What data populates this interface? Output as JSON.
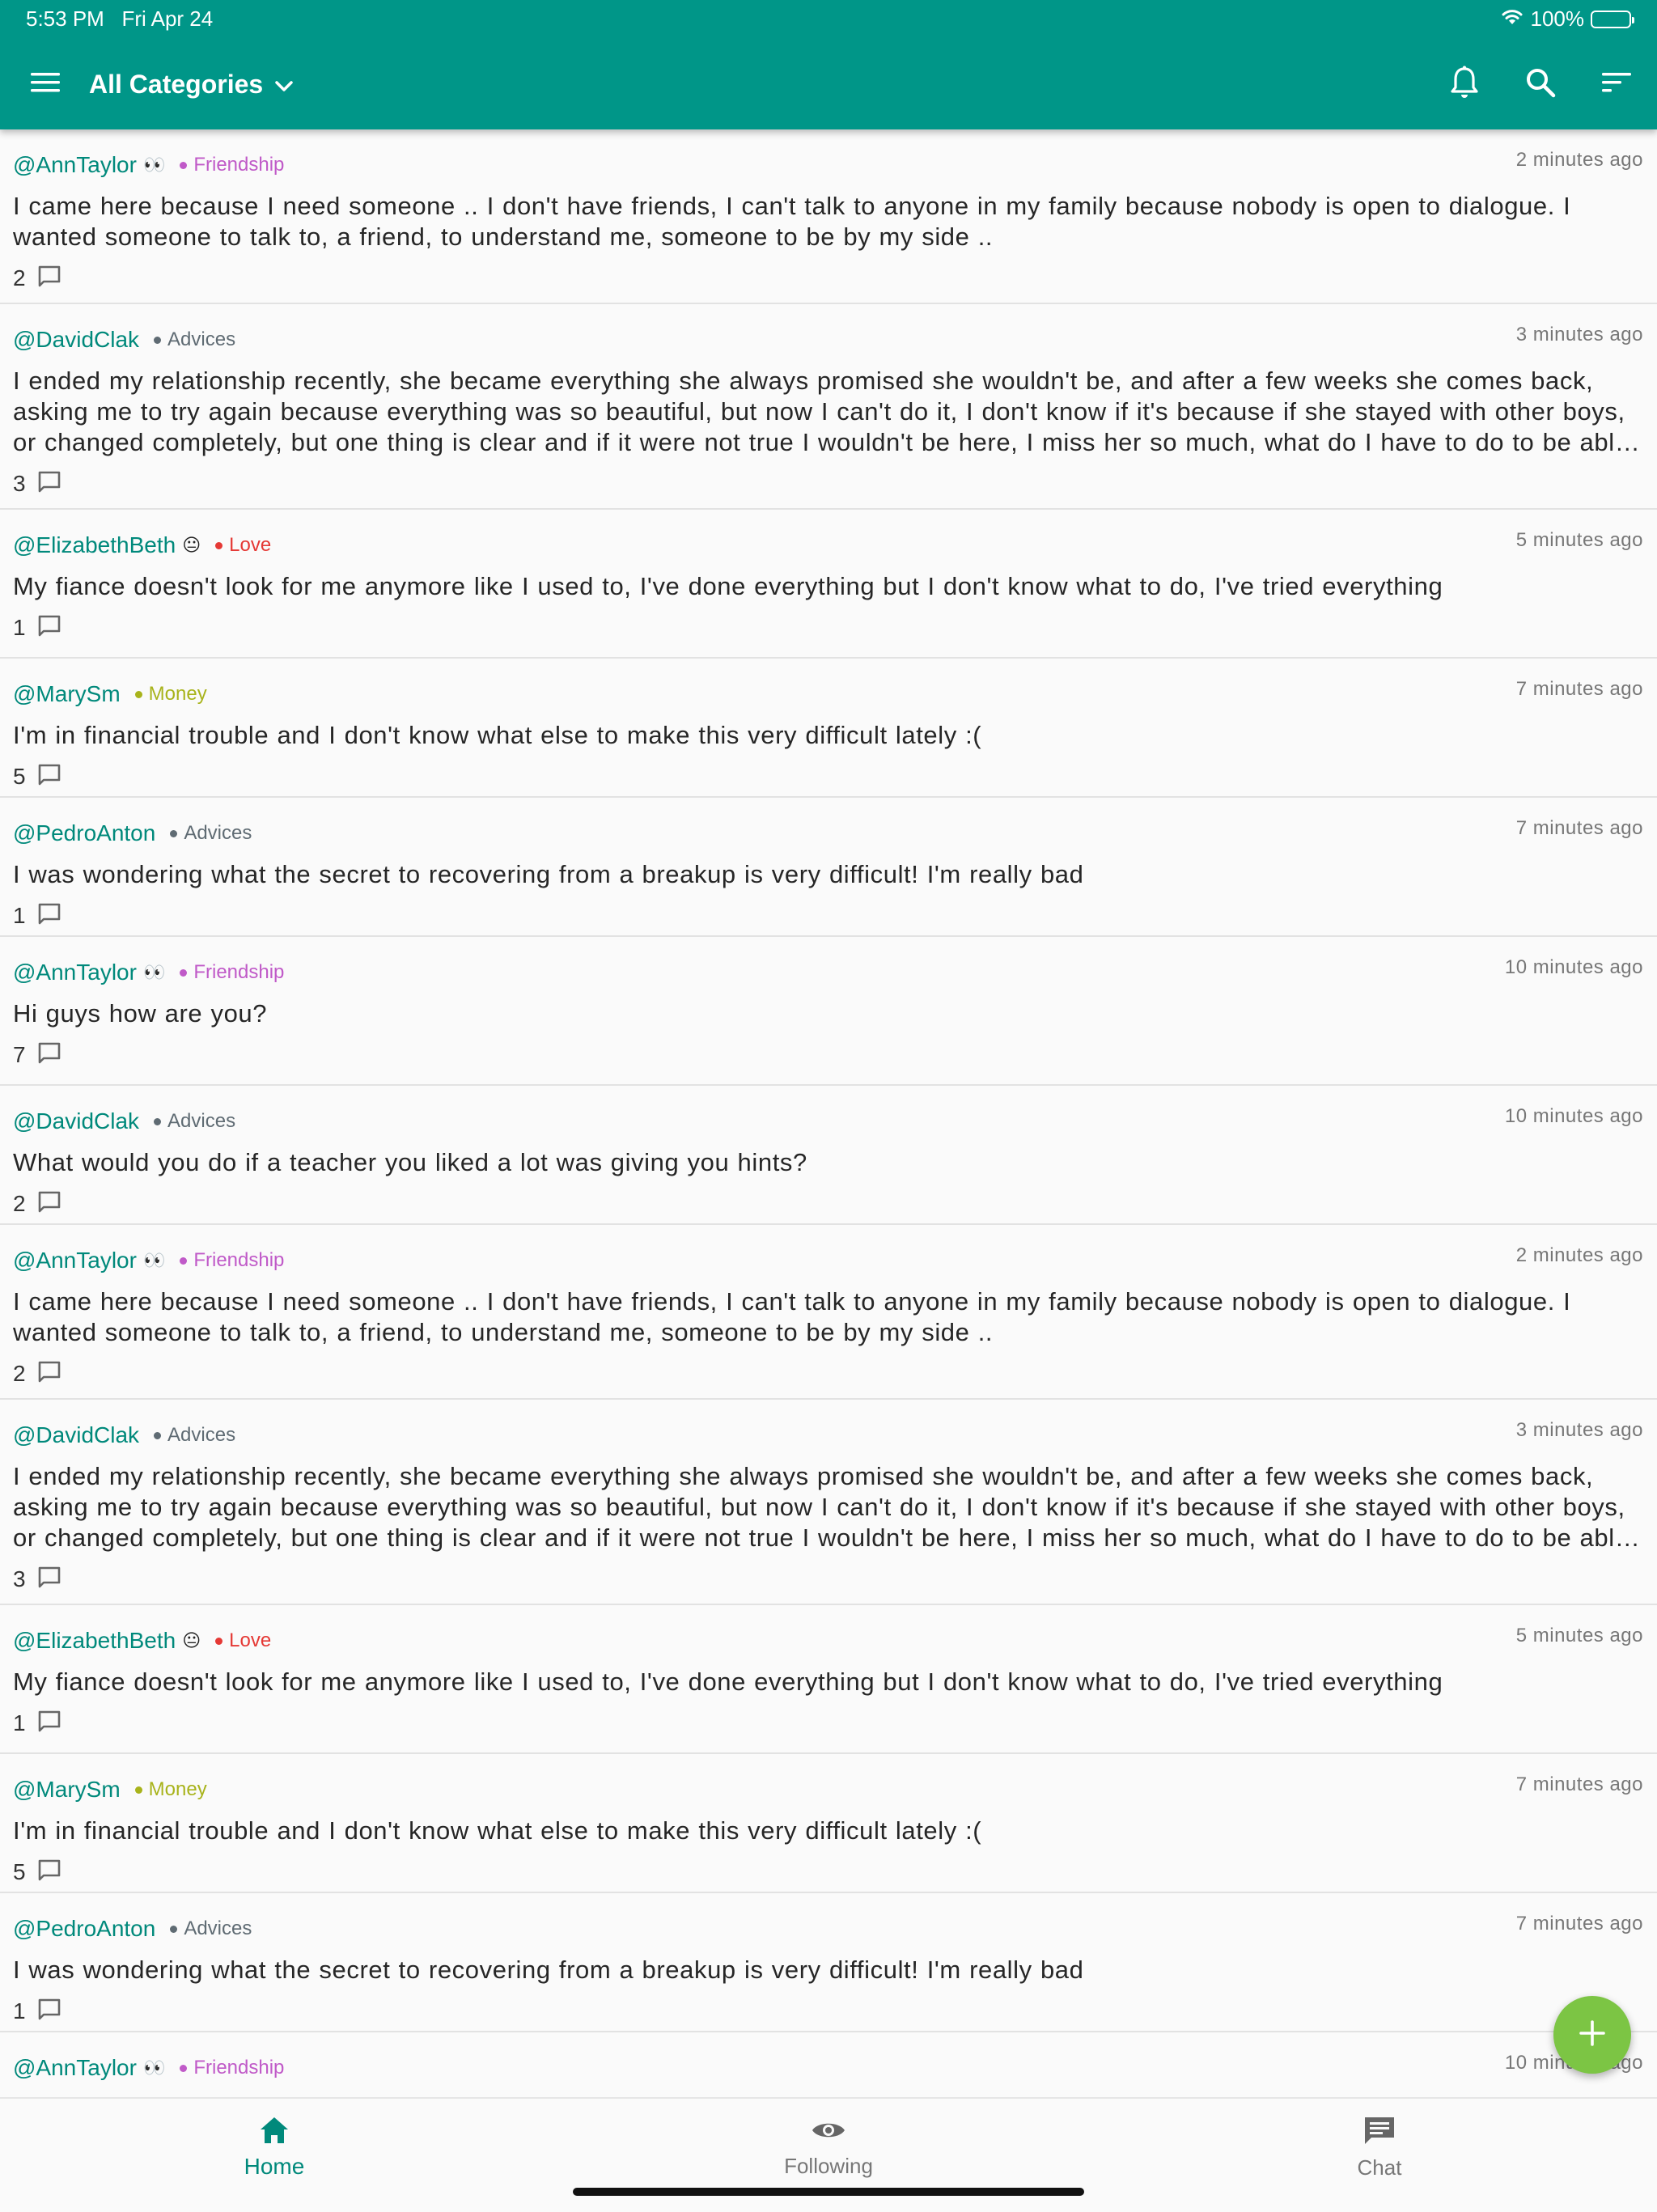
{
  "status_bar": {
    "time": "5:53 PM",
    "date": "Fri Apr 24",
    "battery": "100%",
    "battery_level": 1.0
  },
  "app_bar": {
    "category": "All Categories",
    "icons": [
      "menu-icon",
      "chevron-down-icon",
      "bell-icon",
      "search-icon",
      "sort-icon"
    ]
  },
  "colors": {
    "primary": "#009688",
    "accent_text": "#00897b",
    "fab": "#7cc544",
    "friendship": "#c05ac8",
    "advices": "#5f6b73",
    "love": "#e53935",
    "money": "#a8b31b"
  },
  "posts": [
    {
      "user": "@AnnTaylor",
      "emoji": "👀",
      "category": "Friendship",
      "time": "2 minutes ago",
      "text": "I came here because I need someone .. I don't have friends, I can't talk to anyone in my family because nobody is open to dialogue. I wanted someone to talk to, a friend, to understand me, someone to be by my side ..",
      "comments": "2"
    },
    {
      "user": "@DavidClak",
      "emoji": "",
      "category": "Advices",
      "time": "3 minutes ago",
      "text": "I ended my relationship recently, she became everything she always promised she wouldn't be, and after a few weeks she comes back, asking me to try again because everything was so beautiful, but now I can't do it, I don't know if it's because if she stayed with other boys, or changed completely, but one thing is clear and if it were not true I wouldn't be here, I miss her so much, what do I have to do to be able to forget her?",
      "comments": "3"
    },
    {
      "user": "@ElizabethBeth",
      "emoji": "😐",
      "category": "Love",
      "time": "5 minutes ago",
      "text": "My fiance doesn't look for me anymore like I used to, I've done everything but I don't know what to do, I've tried everything",
      "comments": "1"
    },
    {
      "user": "@MarySm",
      "emoji": "",
      "category": "Money",
      "time": "7 minutes ago",
      "text": "I'm in financial trouble and I don't know what else to make this very difficult lately :(",
      "comments": "5"
    },
    {
      "user": "@PedroAnton",
      "emoji": "",
      "category": "Advices",
      "time": "7 minutes ago",
      "text": "I was wondering what the secret to recovering from a breakup is very difficult! I'm really bad",
      "comments": "1"
    },
    {
      "user": "@AnnTaylor",
      "emoji": "👀",
      "category": "Friendship",
      "time": "10 minutes ago",
      "text": "Hi guys how are you?",
      "comments": "7"
    },
    {
      "user": "@DavidClak",
      "emoji": "",
      "category": "Advices",
      "time": "10 minutes ago",
      "text": "What would you do if a teacher you liked a lot was giving you hints?",
      "comments": "2"
    },
    {
      "user": "@AnnTaylor",
      "emoji": "👀",
      "category": "Friendship",
      "time": "2 minutes ago",
      "text": "I came here because I need someone .. I don't have friends, I can't talk to anyone in my family because nobody is open to dialogue. I wanted someone to talk to, a friend, to understand me, someone to be by my side ..",
      "comments": "2"
    },
    {
      "user": "@DavidClak",
      "emoji": "",
      "category": "Advices",
      "time": "3 minutes ago",
      "text": "I ended my relationship recently, she became everything she always promised she wouldn't be, and after a few weeks she comes back, asking me to try again because everything was so beautiful, but now I can't do it, I don't know if it's because if she stayed with other boys, or changed completely, but one thing is clear and if it were not true I wouldn't be here, I miss her so much, what do I have to do to be able to forget her?",
      "comments": "3"
    },
    {
      "user": "@ElizabethBeth",
      "emoji": "😐",
      "category": "Love",
      "time": "5 minutes ago",
      "text": "My fiance doesn't look for me anymore like I used to, I've done everything but I don't know what to do, I've tried everything",
      "comments": "1"
    },
    {
      "user": "@MarySm",
      "emoji": "",
      "category": "Money",
      "time": "7 minutes ago",
      "text": "I'm in financial trouble and I don't know what else to make this very difficult lately :(",
      "comments": "5"
    },
    {
      "user": "@PedroAnton",
      "emoji": "",
      "category": "Advices",
      "time": "7 minutes ago",
      "text": "I was wondering what the secret to recovering from a breakup is very difficult! I'm really bad",
      "comments": "1"
    },
    {
      "user": "@AnnTaylor",
      "emoji": "👀",
      "category": "Friendship",
      "time": "10 minutes ago",
      "text": "",
      "comments": ""
    }
  ],
  "fab": {
    "icon": "plus-icon"
  },
  "bottom_nav": [
    {
      "label": "Home",
      "icon": "home-icon",
      "active": true
    },
    {
      "label": "Following",
      "icon": "eye-icon",
      "active": false
    },
    {
      "label": "Chat",
      "icon": "chat-icon",
      "active": false
    }
  ]
}
